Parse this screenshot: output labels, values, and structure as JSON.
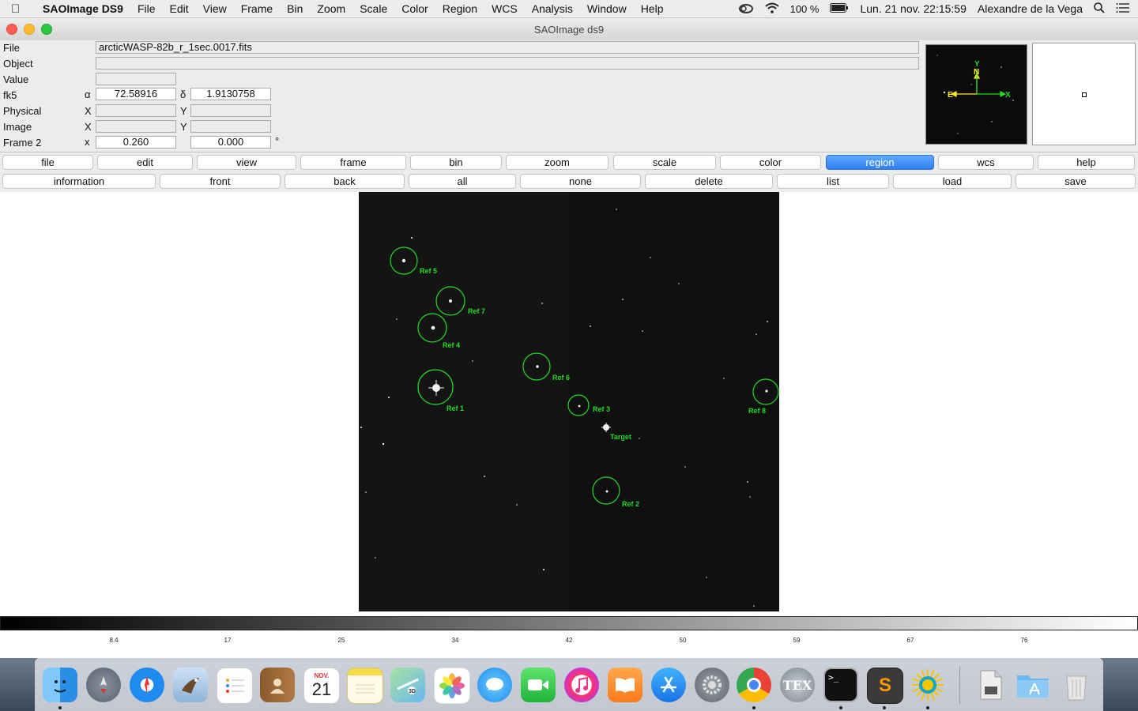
{
  "menubar": {
    "app_name": "SAOImage DS9",
    "items": [
      "File",
      "Edit",
      "View",
      "Frame",
      "Bin",
      "Zoom",
      "Scale",
      "Color",
      "Region",
      "WCS",
      "Analysis",
      "Window",
      "Help"
    ],
    "battery": "100 %",
    "clock": "Lun. 21 nov.  22:15:59",
    "user": "Alexandre de la Vega"
  },
  "window": {
    "title": "SAOImage ds9"
  },
  "info": {
    "file_label": "File",
    "file_value": "arcticWASP-82b_r_1sec.0017.fits",
    "object_label": "Object",
    "object_value": "",
    "value_label": "Value",
    "value_value": "",
    "fk5_label": "fk5",
    "alpha_symbol": "α",
    "alpha_value": "72.58916",
    "delta_symbol": "δ",
    "delta_value": "1.9130758",
    "physical_label": "Physical",
    "physical_x_label": "X",
    "physical_y_label": "Y",
    "image_label": "Image",
    "image_x_label": "X",
    "image_y_label": "Y",
    "frame_label": "Frame 2",
    "frame_x_label": "x",
    "frame_zoom": "0.260",
    "frame_angle": "0.000",
    "degree_symbol": "°"
  },
  "panner": {
    "north": "N",
    "y": "Y",
    "east": "E",
    "x": "X"
  },
  "buttons": {
    "main": [
      "file",
      "edit",
      "view",
      "frame",
      "bin",
      "zoom",
      "scale",
      "color",
      "region",
      "wcs",
      "help"
    ],
    "active": "region",
    "sub": [
      "information",
      "front",
      "back",
      "all",
      "none",
      "delete",
      "list",
      "load",
      "save"
    ]
  },
  "regions": [
    "Ref 5",
    "Ref 7",
    "Ref 4",
    "Ref 1",
    "Ref 6",
    "Ref 3",
    "Target",
    "Ref 2",
    "Ref 8"
  ],
  "colorbar_ticks": [
    "8.4",
    "17",
    "25",
    "34",
    "42",
    "50",
    "59",
    "67",
    "76"
  ],
  "colors": {
    "region_green": "#22dd22",
    "active_button": "#2f7ef4",
    "frame_bg": "#141414"
  },
  "dock": {
    "icons": [
      "finder-icon",
      "launchpad-icon",
      "safari-icon",
      "eagle-icon",
      "reminders-icon",
      "contacts-icon",
      "calendar-icon",
      "notes-icon",
      "maps-icon",
      "photos-icon",
      "messages-icon",
      "facetime-icon",
      "itunes-icon",
      "ibooks-icon",
      "app-store-icon",
      "system-preferences-icon",
      "chrome-icon",
      "tex-icon",
      "terminal-icon",
      "sublime-icon",
      "ds9-icon",
      "document-icon",
      "applications-folder-icon",
      "trash-icon"
    ],
    "calendar_month": "NOV.",
    "calendar_day": "21",
    "terminal_prompt": ">_",
    "tex_label": "TEX",
    "sublime_label": "S"
  }
}
